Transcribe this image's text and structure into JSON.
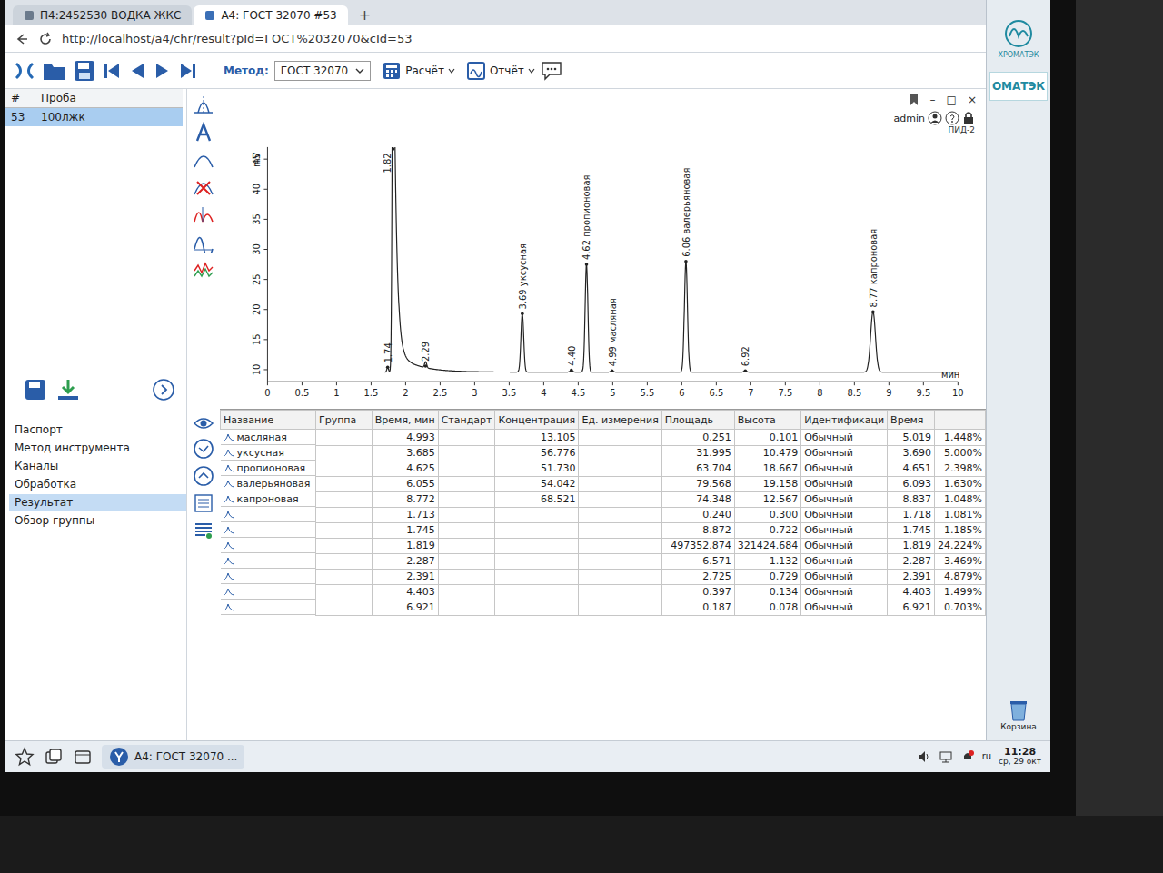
{
  "browser": {
    "tabs": [
      {
        "label": "П4:2452530 ВОДКА ЖКС",
        "selected": false
      },
      {
        "label": "А4: ГОСТ 32070 #53",
        "selected": true
      }
    ],
    "new_tab": "+",
    "address": "http://localhost/a4/chr/result?pId=ГОСТ%2032070&cId=53"
  },
  "toolbar": {
    "method_label": "Метод:",
    "method_value": "ГОСТ 32070",
    "buttons": [
      "Расчёт",
      "Отчёт"
    ]
  },
  "samples": {
    "columns": [
      "#",
      "Проба"
    ],
    "rows": [
      {
        "id": "53",
        "name": "100лжк",
        "selected": true
      }
    ]
  },
  "nav": [
    {
      "label": "Паспорт",
      "selected": false
    },
    {
      "label": "Метод инструмента",
      "selected": false
    },
    {
      "label": "Каналы",
      "selected": false
    },
    {
      "label": "Обработка",
      "selected": false
    },
    {
      "label": "Результат",
      "selected": true
    },
    {
      "label": "Обзор группы",
      "selected": false
    }
  ],
  "chart": {
    "window_controls": [
      "–",
      "□",
      "×"
    ],
    "user": "admin",
    "channel": "ПИД-2",
    "y_unit": "mV",
    "x_unit": "мин",
    "y_ticks": [
      "10",
      "15",
      "20",
      "25",
      "30",
      "35",
      "40",
      "45"
    ],
    "x_ticks": [
      "0",
      "0.5",
      "1",
      "1.5",
      "2",
      "2.5",
      "3",
      "3.5",
      "4",
      "4.5",
      "5",
      "5.5",
      "6",
      "6.5",
      "7",
      "7.5",
      "8",
      "8.5",
      "9",
      "9.5",
      "10"
    ],
    "x_min": 0,
    "x_max": 10,
    "y_min": 8,
    "y_max": 47,
    "baseline": 9.6,
    "trace_start": 1.7,
    "peaks": [
      {
        "label": "1.74",
        "time": 1.74,
        "height": 10.4,
        "sigma": 0.012,
        "kind": "peak"
      },
      {
        "label": "1.82",
        "time": 1.82,
        "height": 80,
        "sigma": 0.014,
        "kind": "solvent"
      },
      {
        "label": "2.29",
        "time": 2.29,
        "height": 10.6,
        "sigma": 0.015,
        "kind": "peak"
      },
      {
        "label": "3.69 уксусная",
        "time": 3.69,
        "height": 19.3,
        "sigma": 0.02,
        "kind": "peak"
      },
      {
        "label": "4.40",
        "time": 4.4,
        "height": 9.9,
        "sigma": 0.02,
        "kind": "peak"
      },
      {
        "label": "4.62 пропионовая",
        "time": 4.62,
        "height": 27.5,
        "sigma": 0.02,
        "kind": "peak"
      },
      {
        "label": "4.99 масляная",
        "time": 4.99,
        "height": 9.8,
        "sigma": 0.02,
        "kind": "peak"
      },
      {
        "label": "6.06 валерьяновая",
        "time": 6.06,
        "height": 28,
        "sigma": 0.022,
        "kind": "peak"
      },
      {
        "label": "6.92",
        "time": 6.92,
        "height": 9.8,
        "sigma": 0.02,
        "kind": "peak"
      },
      {
        "label": "8.77 капроновая",
        "time": 8.77,
        "height": 19.6,
        "sigma": 0.035,
        "kind": "peak"
      }
    ]
  },
  "results": {
    "columns": [
      "Название",
      "Группа",
      "Время, мин",
      "Стандарт",
      "Концентрация",
      "Ед. измерения",
      "Площадь",
      "Высота",
      "Идентификаци",
      "Время",
      ""
    ],
    "rows": [
      [
        "масляная",
        "",
        "4.993",
        "",
        "13.105",
        "",
        "0.251",
        "0.101",
        "Обычный",
        "5.019",
        "1.448%"
      ],
      [
        "уксусная",
        "",
        "3.685",
        "",
        "56.776",
        "",
        "31.995",
        "10.479",
        "Обычный",
        "3.690",
        "5.000%"
      ],
      [
        "пропионовая",
        "",
        "4.625",
        "",
        "51.730",
        "",
        "63.704",
        "18.667",
        "Обычный",
        "4.651",
        "2.398%"
      ],
      [
        "валерьяновая",
        "",
        "6.055",
        "",
        "54.042",
        "",
        "79.568",
        "19.158",
        "Обычный",
        "6.093",
        "1.630%"
      ],
      [
        "капроновая",
        "",
        "8.772",
        "",
        "68.521",
        "",
        "74.348",
        "12.567",
        "Обычный",
        "8.837",
        "1.048%"
      ],
      [
        "",
        "",
        "1.713",
        "",
        "",
        "",
        "0.240",
        "0.300",
        "Обычный",
        "1.718",
        "1.081%"
      ],
      [
        "",
        "",
        "1.745",
        "",
        "",
        "",
        "8.872",
        "0.722",
        "Обычный",
        "1.745",
        "1.185%"
      ],
      [
        "",
        "",
        "1.819",
        "",
        "",
        "",
        "497352.874",
        "321424.684",
        "Обычный",
        "1.819",
        "24.224%"
      ],
      [
        "",
        "",
        "2.287",
        "",
        "",
        "",
        "6.571",
        "1.132",
        "Обычный",
        "2.287",
        "3.469%"
      ],
      [
        "",
        "",
        "2.391",
        "",
        "",
        "",
        "2.725",
        "0.729",
        "Обычный",
        "2.391",
        "4.879%"
      ],
      [
        "",
        "",
        "4.403",
        "",
        "",
        "",
        "0.397",
        "0.134",
        "Обычный",
        "4.403",
        "1.499%"
      ],
      [
        "",
        "",
        "6.921",
        "",
        "",
        "",
        "0.187",
        "0.078",
        "Обычный",
        "6.921",
        "0.703%"
      ]
    ]
  },
  "desktop": {
    "logo": "ХРОМАТЭК",
    "banner": "ОМАТЭК",
    "trash": "Корзина"
  },
  "taskbar": {
    "task": "А4: ГОСТ 32070 ...",
    "lang": "ru",
    "time": "11:28",
    "date": "ср, 29 окт"
  }
}
